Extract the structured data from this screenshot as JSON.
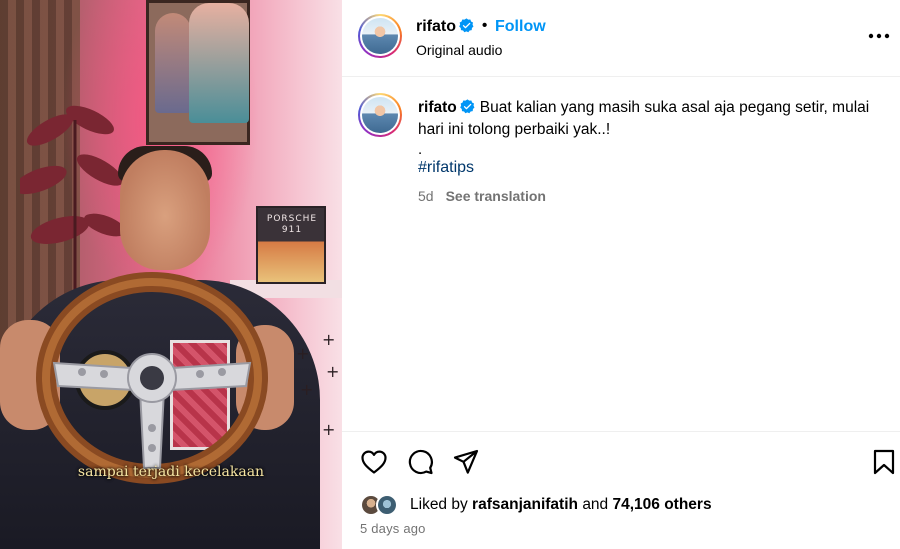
{
  "media": {
    "caption": "sampai terjadi kecelakaan",
    "book_title": "PORSCHE 911"
  },
  "post": {
    "username": "rifato",
    "separator": "•",
    "follow_label": "Follow",
    "audio_label": "Original audio",
    "caption_text": "Buat kalian yang masih suka asal aja pegang setir, mulai hari ini tolong perbaiki yak..!",
    "caption_period": ".",
    "hashtag": "#rifatips",
    "age": "5d",
    "see_translation": "See translation",
    "liked_by_prefix": "Liked by",
    "liked_by_user": "rafsanjanifatih",
    "liked_by_and": "and",
    "liked_by_others": "74,106 others",
    "posted_date": "5 days ago"
  },
  "icons": {
    "verified": "verified-badge-icon",
    "more": "more-options-icon",
    "like": "heart-icon",
    "comment": "comment-bubble-icon",
    "share": "paper-plane-icon",
    "save": "bookmark-icon"
  },
  "colors": {
    "accent_blue": "#0095f6",
    "hashtag_blue": "#00376b",
    "muted_gray": "#737373",
    "verified_blue": "#0095f6"
  }
}
